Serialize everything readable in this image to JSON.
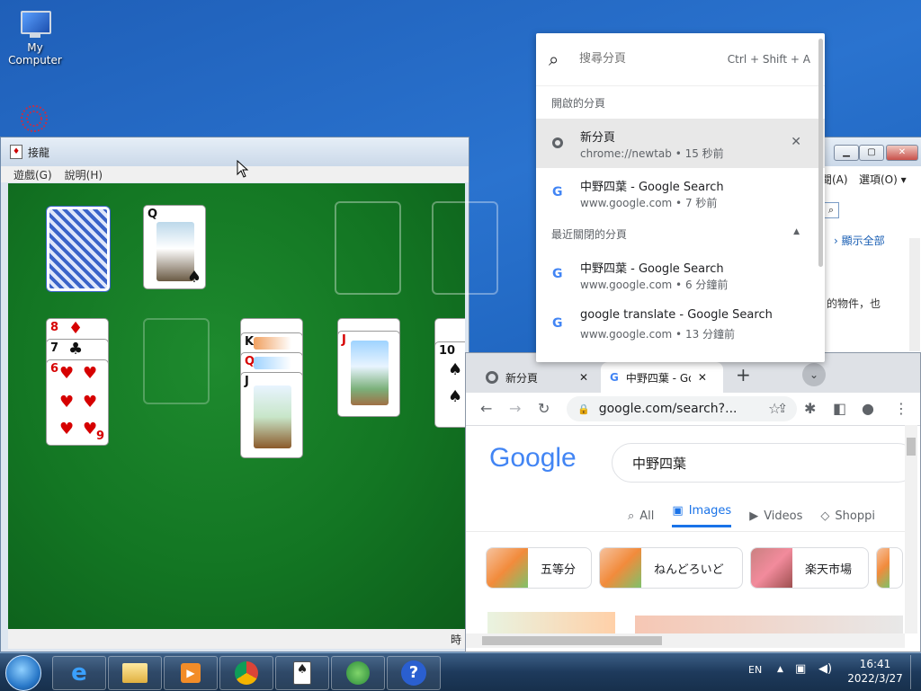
{
  "desktop": {
    "icons": [
      {
        "label": "My\nComputer",
        "icon": "computer-icon"
      },
      {
        "label": "",
        "icon": "network-icon"
      }
    ]
  },
  "solitaire": {
    "title": "接龍",
    "menu": [
      "遊戲(G)",
      "說明(H)"
    ],
    "status_text": "時",
    "cards": {
      "waste": {
        "rank": "Q",
        "suit": "♠"
      },
      "tableau1": [
        {
          "rank": "8",
          "suit": "♦"
        },
        {
          "rank": "7",
          "suit": "♣"
        },
        {
          "rank": "6",
          "suit": "♥"
        },
        {
          "rank": "9",
          "suit": "♥"
        }
      ],
      "tableau3": [
        {
          "rank": "K",
          "suit": "♣"
        },
        {
          "rank": "Q",
          "suit": "♥"
        },
        {
          "rank": "J",
          "suit": "♣"
        }
      ],
      "tableau4": [
        {
          "rank": "J",
          "suit": "♥"
        }
      ],
      "tableau5": [
        {
          "rank": "10",
          "suit": "♠"
        }
      ]
    }
  },
  "behind_window": {
    "menu": [
      "閱(A)",
      "選項(O)"
    ],
    "link": "顯示全部",
    "text": "的物件，也"
  },
  "tab_search": {
    "placeholder": "搜尋分頁",
    "shortcut": "Ctrl + Shift + A",
    "open_tabs_header": "開啟的分頁",
    "open_tabs": [
      {
        "title": "新分頁",
        "subtitle": "chrome://newtab • 15 秒前",
        "icon": "chrome-icon"
      },
      {
        "title": "中野四葉 - Google Search",
        "subtitle": "www.google.com • 7 秒前",
        "icon": "google-icon"
      }
    ],
    "recent_header": "最近關閉的分頁",
    "recent_tabs": [
      {
        "title": "中野四葉 - Google Search",
        "subtitle": "www.google.com • 6 分鐘前",
        "icon": "google-icon"
      },
      {
        "title": "google translate - Google Search",
        "subtitle": "www.google.com • 13 分鐘前",
        "icon": "google-icon"
      }
    ]
  },
  "chrome": {
    "tabs": [
      {
        "title": "新分頁"
      },
      {
        "title": "中野四葉 - Go"
      }
    ],
    "new_tab": "+",
    "url": "google.com/search?...",
    "logo": "Google",
    "search_query": "中野四葉",
    "search_tabs": [
      "All",
      "Images",
      "Videos",
      "Shoppi"
    ],
    "active_search_tab": "Images",
    "chips": [
      "五等分",
      "ねんどろいど",
      "楽天市場"
    ]
  },
  "taskbar": {
    "language": "EN",
    "time": "16:41",
    "date": "2022/3/27",
    "apps": [
      "internet-explorer-icon",
      "file-explorer-icon",
      "media-player-icon",
      "chrome-icon",
      "solitaire-icon",
      "windows-icon",
      "help-icon"
    ]
  },
  "colors": {
    "felt": "#137623",
    "accent_blue": "#1a73e8",
    "desktop": "#1f5fb8"
  }
}
